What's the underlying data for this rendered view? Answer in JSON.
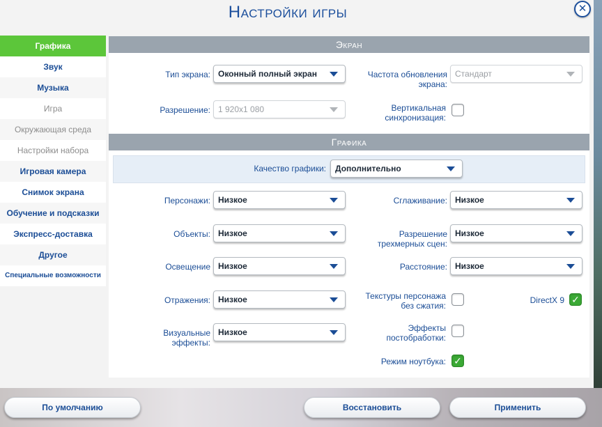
{
  "title": "Настройки игры",
  "close_symbol": "✕",
  "sidebar": {
    "items": [
      {
        "label": "Графика"
      },
      {
        "label": "Звук"
      },
      {
        "label": "Музыка"
      },
      {
        "label": "Игра"
      },
      {
        "label": "Окружающая среда"
      },
      {
        "label": "Настройки набора"
      },
      {
        "label": "Игровая камера"
      },
      {
        "label": "Снимок экрана"
      },
      {
        "label": "Обучение и подсказки"
      },
      {
        "label": "Экспресс-доставка"
      },
      {
        "label": "Другое"
      },
      {
        "label": "Специальные возможности"
      }
    ],
    "active_index": 0
  },
  "screen_section": {
    "header": "Экран",
    "screen_type_label": "Тип экрана:",
    "screen_type_value": "Оконный полный экран",
    "refresh_label_1": "Частота обновления",
    "refresh_label_2": "экрана:",
    "refresh_value": "Стандарт",
    "resolution_label": "Разрешение:",
    "resolution_value": "1 920x1 080",
    "vsync_label_1": "Вертикальная",
    "vsync_label_2": "синхронизация:",
    "vsync_checked": false
  },
  "graphics_section": {
    "header": "Графика",
    "quality_label": "Качество графики:",
    "quality_value": "Дополнительно",
    "characters_label": "Персонажи:",
    "characters_value": "Низкое",
    "antialias_label": "Сглаживание:",
    "antialias_value": "Низкое",
    "objects_label": "Объекты:",
    "objects_value": "Низкое",
    "scene_res_label_1": "Разрешение",
    "scene_res_label_2": "трехмерных сцен:",
    "scene_res_value": "Низкое",
    "lighting_label": "Освещение",
    "lighting_value": "Низкое",
    "distance_label": "Расстояние:",
    "distance_value": "Низкое",
    "reflections_label": "Отражения:",
    "reflections_value": "Низкое",
    "textures_label_1": "Текстуры персонажа",
    "textures_label_2": "без сжатия:",
    "textures_checked": false,
    "directx_label": "DirectX 9",
    "directx_checked": true,
    "visual_fx_label_1": "Визуальные",
    "visual_fx_label_2": "эффекты:",
    "visual_fx_value": "Низкое",
    "postfx_label_1": "Эффекты",
    "postfx_label_2": "постобработки:",
    "postfx_checked": false,
    "laptop_label": "Режим ноутбука:",
    "laptop_checked": true
  },
  "footer": {
    "defaults_label": "По умолчанию",
    "restore_label": "Восстановить",
    "apply_label": "Применить"
  },
  "icons": {
    "close": "close-icon",
    "dropdown": "chevron-down-icon",
    "check": "checkmark-icon"
  },
  "colors": {
    "accent_blue": "#1b4d96",
    "active_green": "#5cc63a",
    "header_gray": "#9aa4ae",
    "check_green": "#3ba935"
  }
}
